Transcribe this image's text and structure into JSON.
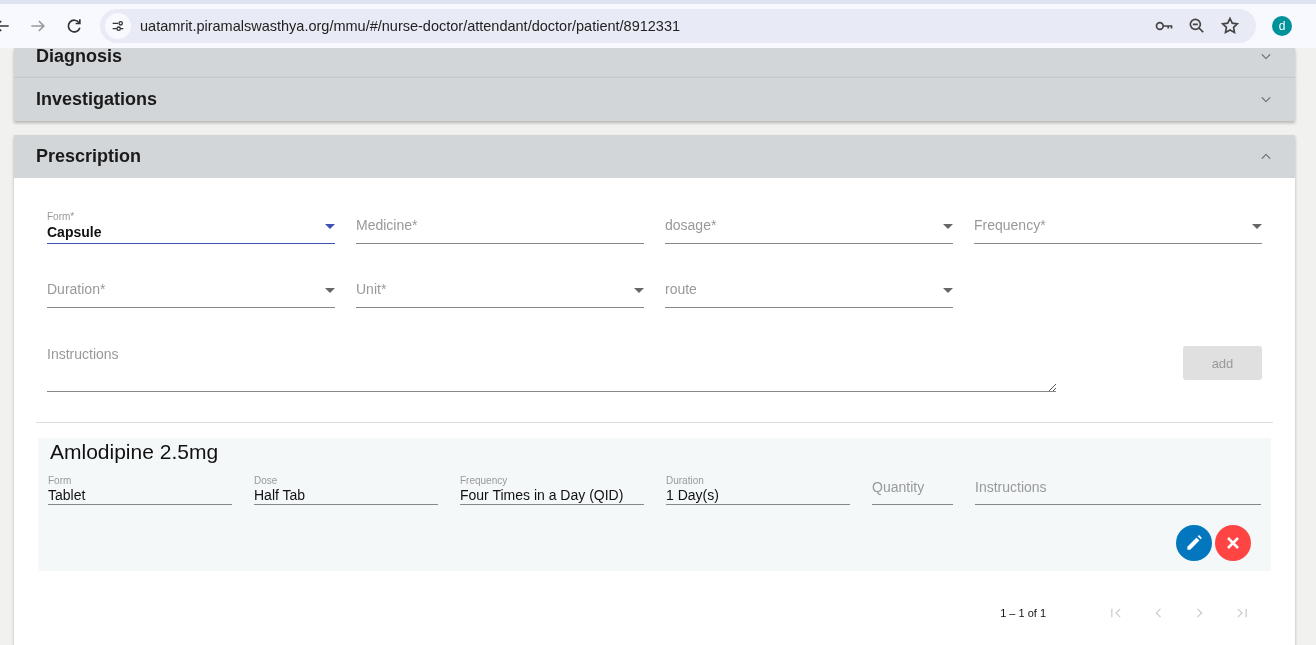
{
  "browser": {
    "url": "uatamrit.piramalswasthya.org/mmu/#/nurse-doctor/attendant/doctor/patient/8912331",
    "avatar": "d",
    "forward_disabled": true
  },
  "sections": [
    {
      "title": "Diagnosis",
      "expanded": false
    },
    {
      "title": "Investigations",
      "expanded": false
    },
    {
      "title": "Prescription",
      "expanded": true
    }
  ],
  "prescription_form": {
    "fields": [
      {
        "kind": "select",
        "label": "Form*",
        "value": "Capsule",
        "focused": true
      },
      {
        "kind": "text",
        "label": "Medicine*",
        "focused": false
      },
      {
        "kind": "select",
        "label": "dosage*",
        "focused": false
      },
      {
        "kind": "select",
        "label": "Frequency*",
        "focused": false
      },
      {
        "kind": "select",
        "label": "Duration*",
        "focused": false
      },
      {
        "kind": "select",
        "label": "Unit*",
        "focused": false
      },
      {
        "kind": "select",
        "label": "route",
        "focused": false
      }
    ],
    "instructions": {
      "label": "Instructions"
    },
    "add_button": {
      "label": "add",
      "disabled": true
    }
  },
  "prescribed": [
    {
      "name": "Amlodipine 2.5mg",
      "fields": [
        {
          "label": "Form",
          "value": "Tablet"
        },
        {
          "label": "Dose",
          "value": "Half Tab"
        },
        {
          "label": "Frequency",
          "value": "Four Times in a Day (QID)"
        },
        {
          "label": "Duration",
          "value": "1 Day(s)"
        },
        {
          "label": "Quantity"
        },
        {
          "label": "Instructions"
        }
      ]
    }
  ],
  "paginator": {
    "range": "1 – 1 of 1",
    "first_disabled": true,
    "previous_disabled": true,
    "next_disabled": true,
    "last_disabled": true
  }
}
